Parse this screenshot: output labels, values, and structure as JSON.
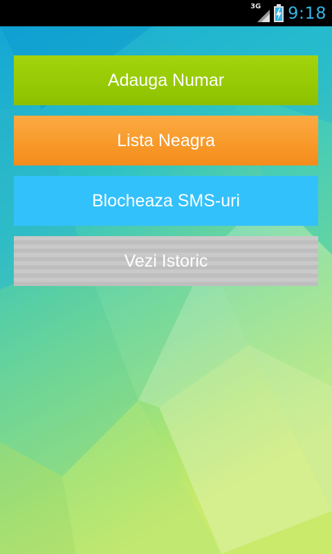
{
  "status_bar": {
    "network_type": "3G",
    "time": "9:18",
    "signal_icon": "signal-icon",
    "battery_icon": "battery-charging-icon",
    "clock_color": "#33b5e5"
  },
  "menu": {
    "buttons": [
      {
        "label": "Adauga Numar",
        "color": "#98cb05"
      },
      {
        "label": "Lista Neagra",
        "color": "#f89a2b"
      },
      {
        "label": "Blocheaza SMS-uri",
        "color": "#33c1fb"
      },
      {
        "label": "Vezi Istoric",
        "color": "#c3c3c3"
      }
    ]
  }
}
